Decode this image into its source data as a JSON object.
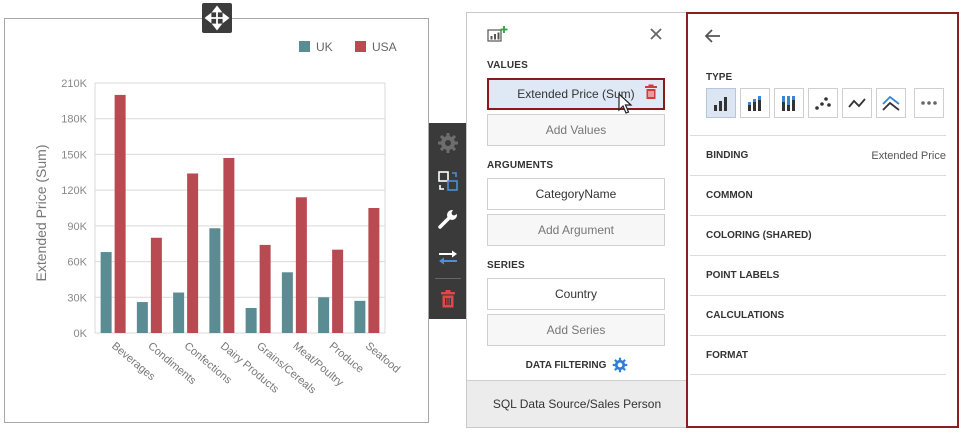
{
  "chart_data": {
    "type": "bar",
    "categories": [
      "Beverages",
      "Condiments",
      "Confections",
      "Dairy Products",
      "Grains/Cereals",
      "Meat/Poultry",
      "Produce",
      "Seafood"
    ],
    "series": [
      {
        "name": "UK",
        "color": "#5b8c93",
        "values": [
          68000,
          26000,
          34000,
          88000,
          21000,
          51000,
          30000,
          27000
        ]
      },
      {
        "name": "USA",
        "color": "#b94a52",
        "values": [
          200000,
          80000,
          134000,
          147000,
          74000,
          114000,
          70000,
          105000
        ]
      }
    ],
    "ylabel": "Extended Price (Sum)",
    "yticks": [
      "0K",
      "30K",
      "60K",
      "90K",
      "120K",
      "150K",
      "180K",
      "210K"
    ],
    "ylim": [
      0,
      210000
    ],
    "grid": true,
    "legend_position": "top-right"
  },
  "toolbar": {
    "items": [
      "gear-icon",
      "convert-icon",
      "wrench-icon",
      "swap-icon",
      "trash-icon"
    ]
  },
  "binding_panel": {
    "values_title": "VALUES",
    "value_field": "Extended Price (Sum)",
    "add_values": "Add Values",
    "arguments_title": "ARGUMENTS",
    "argument_field": "CategoryName",
    "add_argument": "Add Argument",
    "series_title": "SERIES",
    "series_field": "Country",
    "add_series": "Add Series",
    "data_filtering": "DATA FILTERING",
    "data_source": "SQL Data Source/Sales Person"
  },
  "options_panel": {
    "type_title": "TYPE",
    "type_buttons": [
      "bar",
      "stacked-bar",
      "full-stacked-bar",
      "point",
      "line",
      "range-area",
      "more"
    ],
    "selected_type": "bar",
    "rows": [
      {
        "label": "BINDING",
        "value": "Extended Price"
      },
      {
        "label": "COMMON",
        "value": ""
      },
      {
        "label": "COLORING (SHARED)",
        "value": ""
      },
      {
        "label": "POINT LABELS",
        "value": ""
      },
      {
        "label": "CALCULATIONS",
        "value": ""
      },
      {
        "label": "FORMAT",
        "value": ""
      }
    ]
  }
}
